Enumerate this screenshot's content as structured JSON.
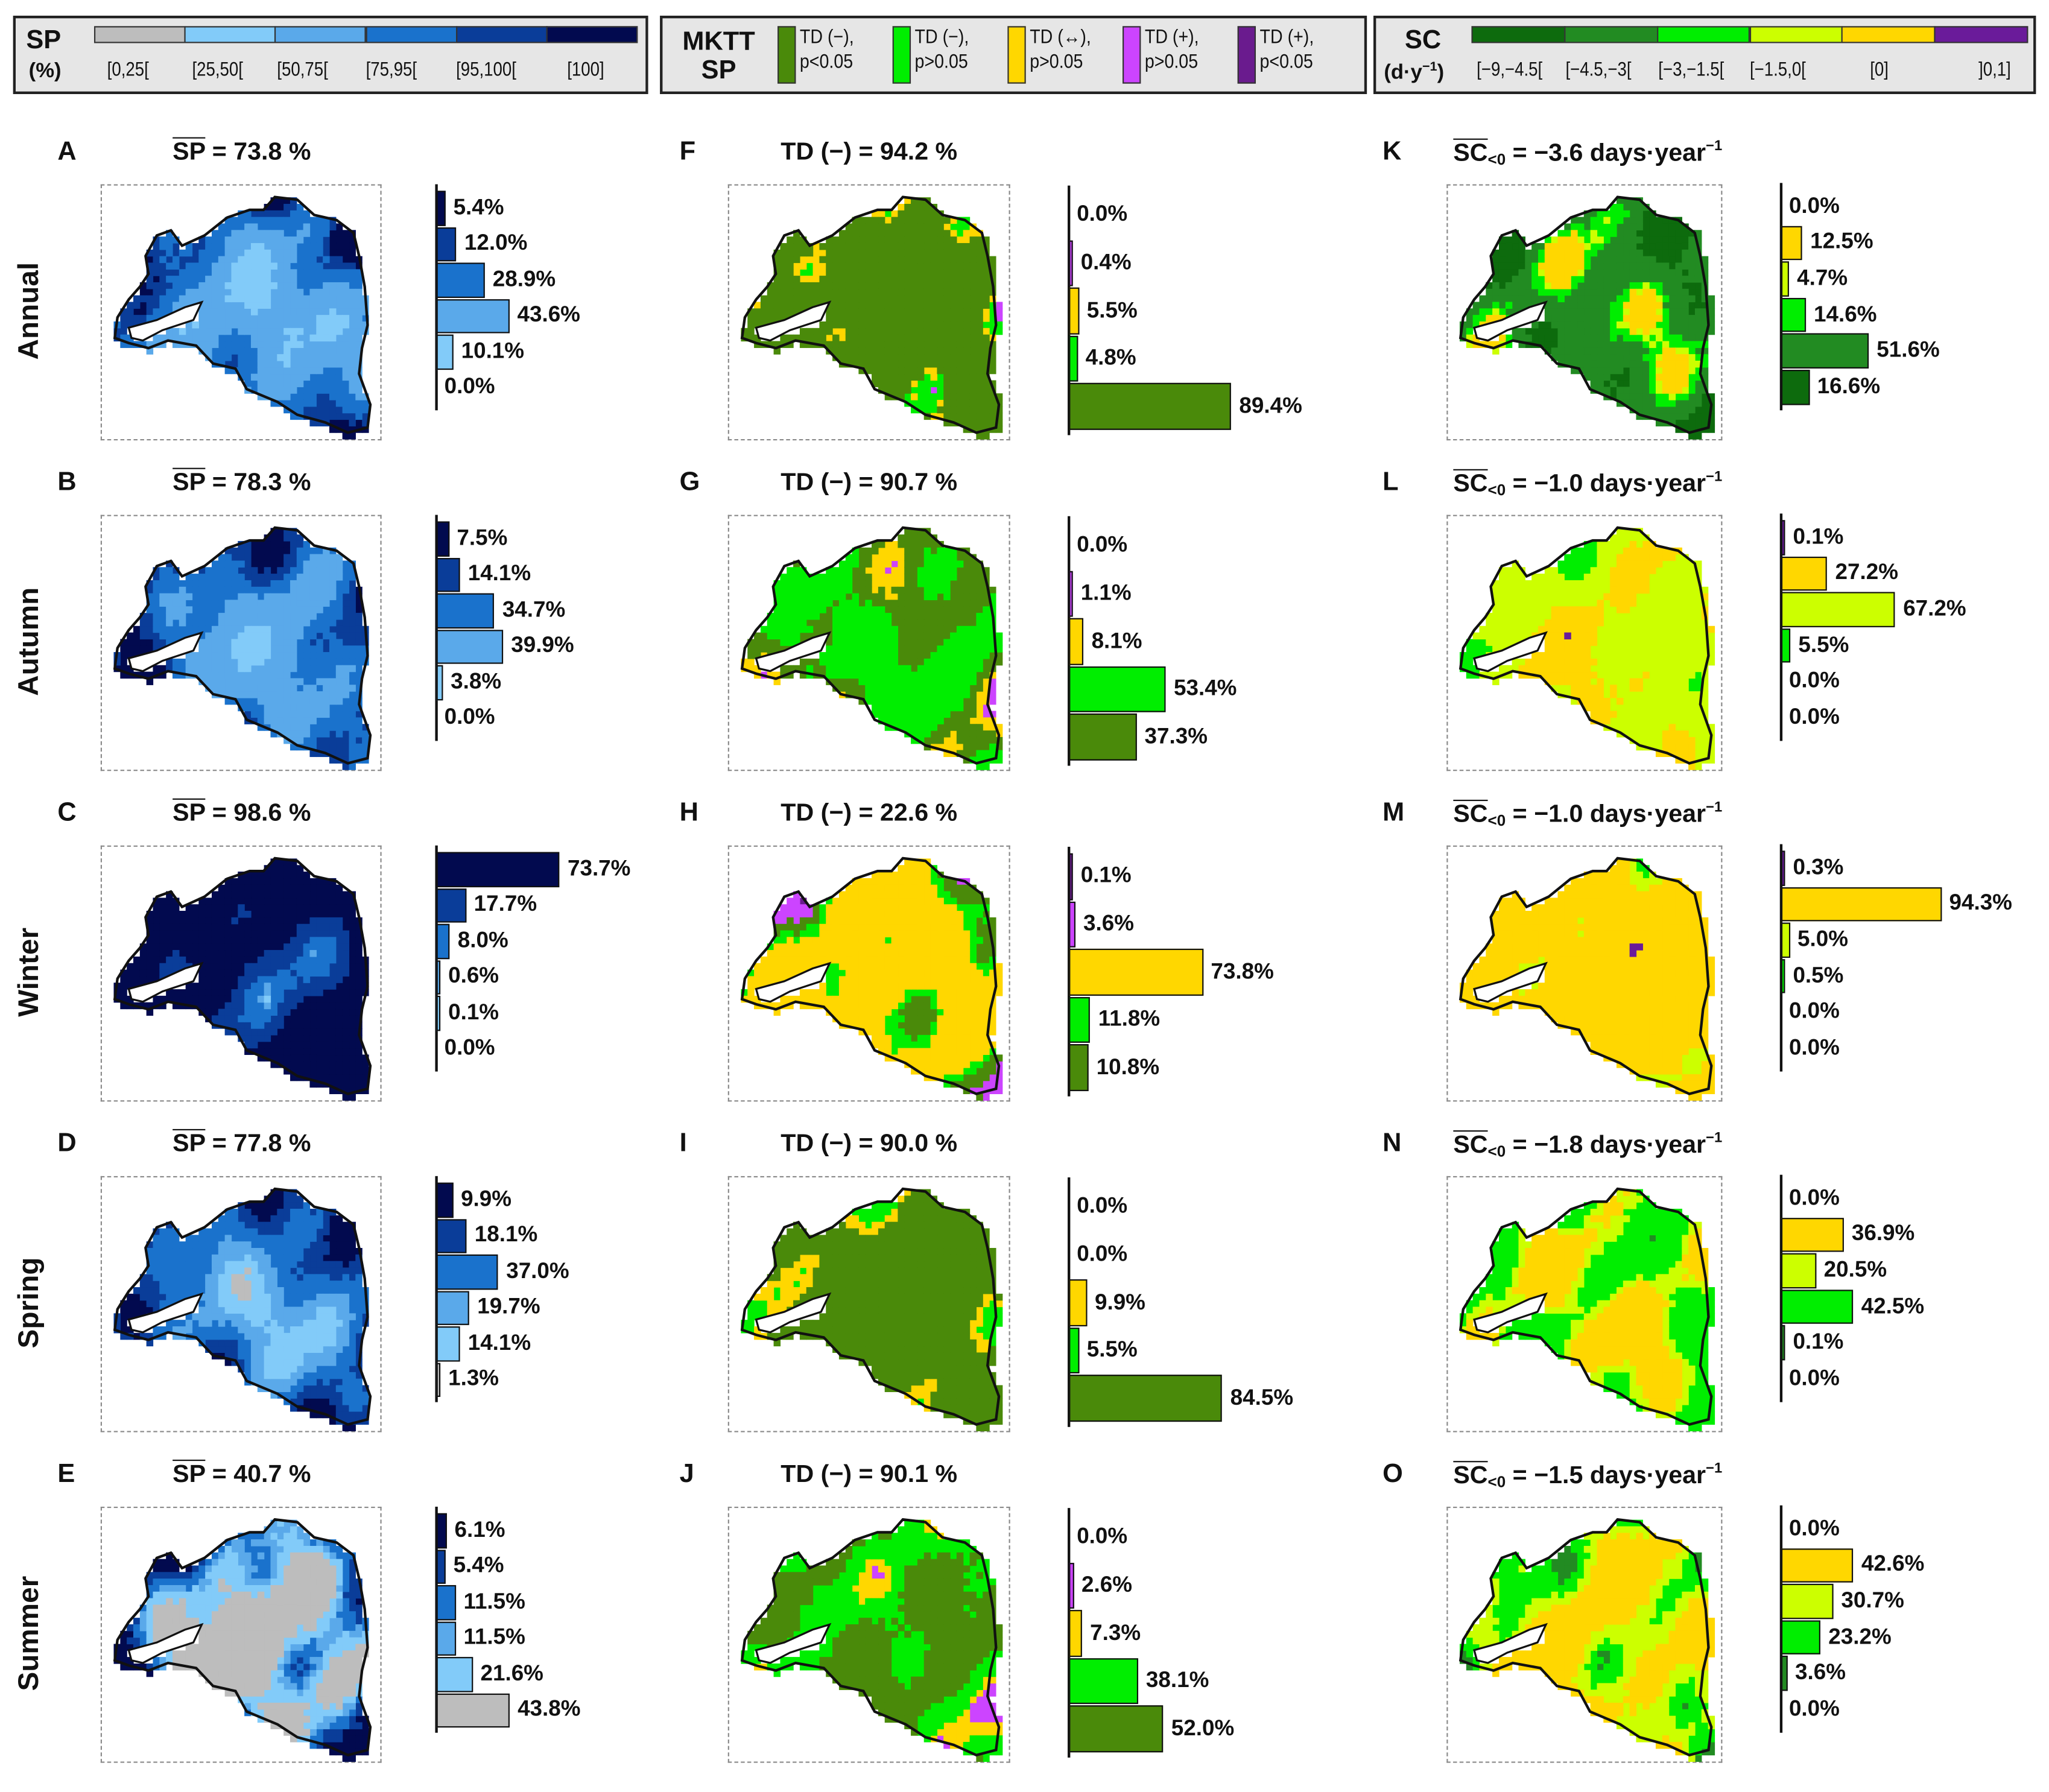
{
  "legends": {
    "sp": {
      "title": "SP",
      "unit": "(%)",
      "classes": [
        {
          "label": "[0,25[",
          "color": "#bdbdbd"
        },
        {
          "label": "[25,50[",
          "color": "#82cbf9"
        },
        {
          "label": "[50,75[",
          "color": "#5aa9ea"
        },
        {
          "label": "[75,95[",
          "color": "#1a72cc"
        },
        {
          "label": "[95,100[",
          "color": "#0a3d99"
        },
        {
          "label": "[100]",
          "color": "#020a4f"
        }
      ]
    },
    "mktt": {
      "title_line1": "MKTT",
      "title_line2": "SP",
      "classes": [
        {
          "line1": "TD (−),",
          "line2": "p<0.05",
          "color": "#4a8a0a"
        },
        {
          "line1": "TD (−),",
          "line2": "p>0.05",
          "color": "#00ee00"
        },
        {
          "line1": "TD (↔),",
          "line2": "p>0.05",
          "color": "#ffd700"
        },
        {
          "line1": "TD (+),",
          "line2": "p>0.05",
          "color": "#cc44ff"
        },
        {
          "line1": "TD (+),",
          "line2": "p<0.05",
          "color": "#6a1b8e"
        }
      ]
    },
    "sc": {
      "title": "SC",
      "unit_base": "(d·y",
      "unit_sup": "−1",
      "unit_end": ")",
      "classes": [
        {
          "label": "[−9,−4.5[",
          "color": "#0d6b0d"
        },
        {
          "label": "[−4.5,−3[",
          "color": "#228b22"
        },
        {
          "label": "[−3,−1.5[",
          "color": "#00ee00"
        },
        {
          "label": "[−1.5,0[",
          "color": "#ccff00"
        },
        {
          "label": "[0]",
          "color": "#ffd700"
        },
        {
          "label": "]0,1]",
          "color": "#6a1b9a"
        }
      ]
    }
  },
  "row_labels": [
    "Annual",
    "Autumn",
    "Winter",
    "Spring",
    "Summer"
  ],
  "chart_data": [
    {
      "type": "bar",
      "panel": "A",
      "column": "sp",
      "title": {
        "var": "SP",
        "sub": "",
        "rest": " = 73.8 %",
        "sup": ""
      },
      "categories": [
        "[100]",
        "[95,100[",
        "[75,95[",
        "[50,75[",
        "[25,50[",
        "[0,25["
      ],
      "values": [
        5.4,
        12.0,
        28.9,
        43.6,
        10.1,
        0.0
      ],
      "unit": "%"
    },
    {
      "type": "bar",
      "panel": "B",
      "column": "sp",
      "title": {
        "var": "SP",
        "sub": "",
        "rest": " = 78.3 %",
        "sup": ""
      },
      "categories": [
        "[100]",
        "[95,100[",
        "[75,95[",
        "[50,75[",
        "[25,50[",
        "[0,25["
      ],
      "values": [
        7.5,
        14.1,
        34.7,
        39.9,
        3.8,
        0.0
      ],
      "unit": "%"
    },
    {
      "type": "bar",
      "panel": "C",
      "column": "sp",
      "title": {
        "var": "SP",
        "sub": "",
        "rest": " = 98.6 %",
        "sup": ""
      },
      "categories": [
        "[100]",
        "[95,100[",
        "[75,95[",
        "[50,75[",
        "[25,50[",
        "[0,25["
      ],
      "values": [
        73.7,
        17.7,
        8.0,
        0.6,
        0.1,
        0.0
      ],
      "unit": "%"
    },
    {
      "type": "bar",
      "panel": "D",
      "column": "sp",
      "title": {
        "var": "SP",
        "sub": "",
        "rest": " = 77.8 %",
        "sup": ""
      },
      "categories": [
        "[100]",
        "[95,100[",
        "[75,95[",
        "[50,75[",
        "[25,50[",
        "[0,25["
      ],
      "values": [
        9.9,
        18.1,
        37.0,
        19.7,
        14.1,
        1.3
      ],
      "unit": "%"
    },
    {
      "type": "bar",
      "panel": "E",
      "column": "sp",
      "title": {
        "var": "SP",
        "sub": "",
        "rest": " = 40.7 %",
        "sup": ""
      },
      "categories": [
        "[100]",
        "[95,100[",
        "[75,95[",
        "[50,75[",
        "[25,50[",
        "[0,25["
      ],
      "values": [
        6.1,
        5.4,
        11.5,
        11.5,
        21.6,
        43.8
      ],
      "unit": "%"
    },
    {
      "type": "bar",
      "panel": "F",
      "column": "mktt",
      "title": {
        "var": "",
        "sub": "",
        "rest": "TD (−) = 94.2 %",
        "sup": ""
      },
      "categories": [
        "TD (+), p<0.05",
        "TD (+), p>0.05",
        "TD (↔), p>0.05",
        "TD (−), p>0.05",
        "TD (−), p<0.05"
      ],
      "values": [
        0.0,
        0.4,
        5.5,
        4.8,
        89.4
      ],
      "unit": "%"
    },
    {
      "type": "bar",
      "panel": "G",
      "column": "mktt",
      "title": {
        "var": "",
        "sub": "",
        "rest": "TD (−) = 90.7 %",
        "sup": ""
      },
      "categories": [
        "TD (+), p<0.05",
        "TD (+), p>0.05",
        "TD (↔), p>0.05",
        "TD (−), p>0.05",
        "TD (−), p<0.05"
      ],
      "values": [
        0.0,
        1.1,
        8.1,
        53.4,
        37.3
      ],
      "unit": "%"
    },
    {
      "type": "bar",
      "panel": "H",
      "column": "mktt",
      "title": {
        "var": "",
        "sub": "",
        "rest": "TD (−) = 22.6 %",
        "sup": ""
      },
      "categories": [
        "TD (+), p<0.05",
        "TD (+), p>0.05",
        "TD (↔), p>0.05",
        "TD (−), p>0.05",
        "TD (−), p<0.05"
      ],
      "values": [
        0.1,
        3.6,
        73.8,
        11.8,
        10.8
      ],
      "unit": "%"
    },
    {
      "type": "bar",
      "panel": "I",
      "column": "mktt",
      "title": {
        "var": "",
        "sub": "",
        "rest": "TD (−) = 90.0 %",
        "sup": ""
      },
      "categories": [
        "TD (+), p<0.05",
        "TD (+), p>0.05",
        "TD (↔), p>0.05",
        "TD (−), p>0.05",
        "TD (−), p<0.05"
      ],
      "values": [
        0.0,
        0.0,
        9.9,
        5.5,
        84.5
      ],
      "unit": "%"
    },
    {
      "type": "bar",
      "panel": "J",
      "column": "mktt",
      "title": {
        "var": "",
        "sub": "",
        "rest": "TD (−) = 90.1 %",
        "sup": ""
      },
      "categories": [
        "TD (+), p<0.05",
        "TD (+), p>0.05",
        "TD (↔), p>0.05",
        "TD (−), p>0.05",
        "TD (−), p<0.05"
      ],
      "values": [
        0.0,
        2.6,
        7.3,
        38.1,
        52.0
      ],
      "unit": "%"
    },
    {
      "type": "bar",
      "panel": "K",
      "column": "sc",
      "title": {
        "var": "SC",
        "sub": "<0",
        "rest": " = −3.6 days·year",
        "sup": "−1"
      },
      "categories": [
        "]0,1]",
        "[0]",
        "[−1.5,0[",
        "[−3,−1.5[",
        "[−4.5,−3[",
        "[−9,−4.5["
      ],
      "values": [
        0.0,
        12.5,
        4.7,
        14.6,
        51.6,
        16.6
      ],
      "unit": "%"
    },
    {
      "type": "bar",
      "panel": "L",
      "column": "sc",
      "title": {
        "var": "SC",
        "sub": "<0",
        "rest": " = −1.0 days·year",
        "sup": "−1"
      },
      "categories": [
        "]0,1]",
        "[0]",
        "[−1.5,0[",
        "[−3,−1.5[",
        "[−4.5,−3[",
        "[−9,−4.5["
      ],
      "values": [
        0.1,
        27.2,
        67.2,
        5.5,
        0.0,
        0.0
      ],
      "unit": "%"
    },
    {
      "type": "bar",
      "panel": "M",
      "column": "sc",
      "title": {
        "var": "SC",
        "sub": "<0",
        "rest": " = −1.0 days·year",
        "sup": "−1"
      },
      "categories": [
        "]0,1]",
        "[0]",
        "[−1.5,0[",
        "[−3,−1.5[",
        "[−4.5,−3[",
        "[−9,−4.5["
      ],
      "values": [
        0.3,
        94.3,
        5.0,
        0.5,
        0.0,
        0.0
      ],
      "unit": "%"
    },
    {
      "type": "bar",
      "panel": "N",
      "column": "sc",
      "title": {
        "var": "SC",
        "sub": "<0",
        "rest": " = −1.8 days·year",
        "sup": "−1"
      },
      "categories": [
        "]0,1]",
        "[0]",
        "[−1.5,0[",
        "[−3,−1.5[",
        "[−4.5,−3[",
        "[−9,−4.5["
      ],
      "values": [
        0.0,
        36.9,
        20.5,
        42.5,
        0.1,
        0.0
      ],
      "unit": "%"
    },
    {
      "type": "bar",
      "panel": "O",
      "column": "sc",
      "title": {
        "var": "SC",
        "sub": "<0",
        "rest": " = −1.5 days·year",
        "sup": "−1"
      },
      "categories": [
        "]0,1]",
        "[0]",
        "[−1.5,0[",
        "[−3,−1.5[",
        "[−4.5,−3[",
        "[−9,−4.5["
      ],
      "values": [
        0.0,
        42.6,
        30.7,
        23.2,
        3.6,
        0.0
      ],
      "unit": "%"
    }
  ]
}
